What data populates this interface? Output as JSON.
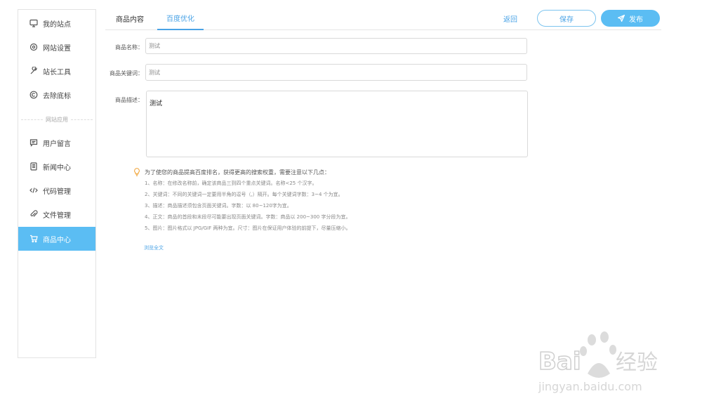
{
  "sidebar": {
    "items": [
      {
        "label": "我的站点",
        "icon": "monitor-icon"
      },
      {
        "label": "网站设置",
        "icon": "gear-icon"
      },
      {
        "label": "站长工具",
        "icon": "wrench-icon"
      },
      {
        "label": "去除底标",
        "icon": "copyright-icon"
      },
      {
        "label": "用户留言",
        "icon": "message-icon"
      },
      {
        "label": "新闻中心",
        "icon": "news-icon"
      },
      {
        "label": "代码管理",
        "icon": "code-icon"
      },
      {
        "label": "文件管理",
        "icon": "paperclip-icon"
      },
      {
        "label": "商品中心",
        "icon": "cart-icon"
      }
    ],
    "section_label": "网站应用",
    "active_index": 8
  },
  "header": {
    "tabs": [
      {
        "label": "商品内容"
      },
      {
        "label": "百度优化"
      }
    ],
    "active_tab": 1,
    "back_label": "返回",
    "save_label": "保存",
    "publish_label": "发布"
  },
  "form": {
    "name_label": "商品名称：",
    "name_placeholder": "测试",
    "keyword_label": "商品关键词：",
    "keyword_placeholder": "测试",
    "desc_label": "商品描述：",
    "desc_value": "测试"
  },
  "tips": {
    "heading": "为了使您的商品提高百度排名，获得更高的搜索权重，需要注意以下几点：",
    "lines": [
      "1、名称：在修改名称前，确定该商品三到四个重点关键词。名称<25 个汉字。",
      "2、关键词：不同的关键词一定要用半角的逗号（,）隔开。每个关键词字数：3~4 个为宜。",
      "3、描述：商品描述须包含页面关键词。字数：以 80~120字为宜。",
      "4、正文：商品的首段和末段尽可能要出现页面关键词。字数：商品以 200~300 字分段为宜。",
      "5、图片：图片格式以 JPG/GIF 两种为宜。尺寸：图片在保证用户体验的前提下，尽量压缩小。"
    ],
    "read_more": "浏览全文"
  },
  "watermark": {
    "brand": "Bai du 经验",
    "url": "jingyan.baidu.com"
  },
  "colors": {
    "accent": "#5bbdf3",
    "link": "#4aa3e6"
  }
}
